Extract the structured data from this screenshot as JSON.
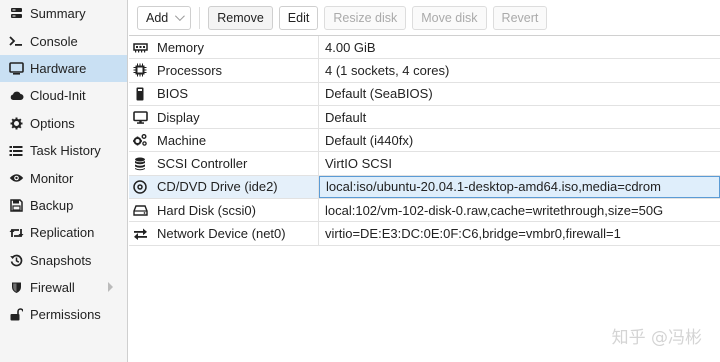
{
  "sidebar": {
    "items": [
      {
        "label": "Summary",
        "icon": "summary-icon"
      },
      {
        "label": "Console",
        "icon": "console-icon"
      },
      {
        "label": "Hardware",
        "icon": "monitor-icon",
        "active": true
      },
      {
        "label": "Cloud-Init",
        "icon": "cloud-icon"
      },
      {
        "label": "Options",
        "icon": "gear-icon"
      },
      {
        "label": "Task History",
        "icon": "list-icon"
      },
      {
        "label": "Monitor",
        "icon": "eye-icon"
      },
      {
        "label": "Backup",
        "icon": "floppy-icon"
      },
      {
        "label": "Replication",
        "icon": "retweet-icon"
      },
      {
        "label": "Snapshots",
        "icon": "history-icon"
      },
      {
        "label": "Firewall",
        "icon": "shield-icon"
      },
      {
        "label": "Permissions",
        "icon": "unlock-icon"
      }
    ]
  },
  "toolbar": {
    "add_label": "Add",
    "remove_label": "Remove",
    "edit_label": "Edit",
    "resize_label": "Resize disk",
    "move_label": "Move disk",
    "revert_label": "Revert"
  },
  "hardware": {
    "rows": [
      {
        "name": "Memory",
        "value": "4.00 GiB",
        "icon": "memory-icon"
      },
      {
        "name": "Processors",
        "value": "4 (1 sockets, 4 cores)",
        "icon": "cpu-icon"
      },
      {
        "name": "BIOS",
        "value": "Default (SeaBIOS)",
        "icon": "bios-icon"
      },
      {
        "name": "Display",
        "value": "Default",
        "icon": "desktop-icon"
      },
      {
        "name": "Machine",
        "value": "Default (i440fx)",
        "icon": "cogs-icon"
      },
      {
        "name": "SCSI Controller",
        "value": "VirtIO SCSI",
        "icon": "database-icon"
      },
      {
        "name": "CD/DVD Drive (ide2)",
        "value": "local:iso/ubuntu-20.04.1-desktop-amd64.iso,media=cdrom",
        "icon": "cdrom-icon",
        "selected": true
      },
      {
        "name": "Hard Disk (scsi0)",
        "value": "local:102/vm-102-disk-0.raw,cache=writethrough,size=50G",
        "icon": "hdd-icon"
      },
      {
        "name": "Network Device (net0)",
        "value": "virtio=DE:E3:DC:0E:0F:C6,bridge=vmbr0,firewall=1",
        "icon": "exchange-icon"
      }
    ]
  },
  "watermark": "知乎 @冯彬"
}
